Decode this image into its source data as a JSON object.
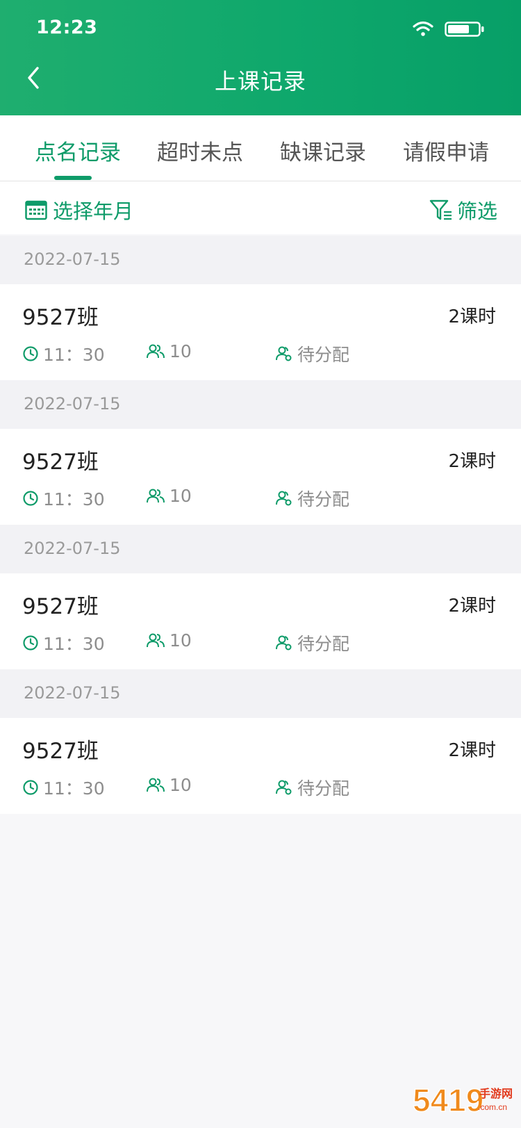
{
  "status_bar": {
    "time": "12:23"
  },
  "header": {
    "title": "上课记录"
  },
  "tabs": [
    {
      "label": "点名记录"
    },
    {
      "label": "超时未点"
    },
    {
      "label": "缺课记录"
    },
    {
      "label": "请假申请"
    }
  ],
  "filter_bar": {
    "month_label": "选择年月",
    "filter_label": "筛选"
  },
  "records": [
    {
      "date": "2022-07-15",
      "class_name": "9527班",
      "hours": "2课时",
      "time": "11：30",
      "count": "10",
      "status": "待分配"
    },
    {
      "date": "2022-07-15",
      "class_name": "9527班",
      "hours": "2课时",
      "time": "11：30",
      "count": "10",
      "status": "待分配"
    },
    {
      "date": "2022-07-15",
      "class_name": "9527班",
      "hours": "2课时",
      "time": "11：30",
      "count": "10",
      "status": "待分配"
    },
    {
      "date": "2022-07-15",
      "class_name": "9527班",
      "hours": "2课时",
      "time": "11：30",
      "count": "10",
      "status": "待分配"
    }
  ],
  "watermark": {
    "text": "5419手游网 .com.cn"
  },
  "colors": {
    "accent": "#0e9b69",
    "header_bg": "#12aa6d",
    "page_bg": "#f7f7f9"
  }
}
